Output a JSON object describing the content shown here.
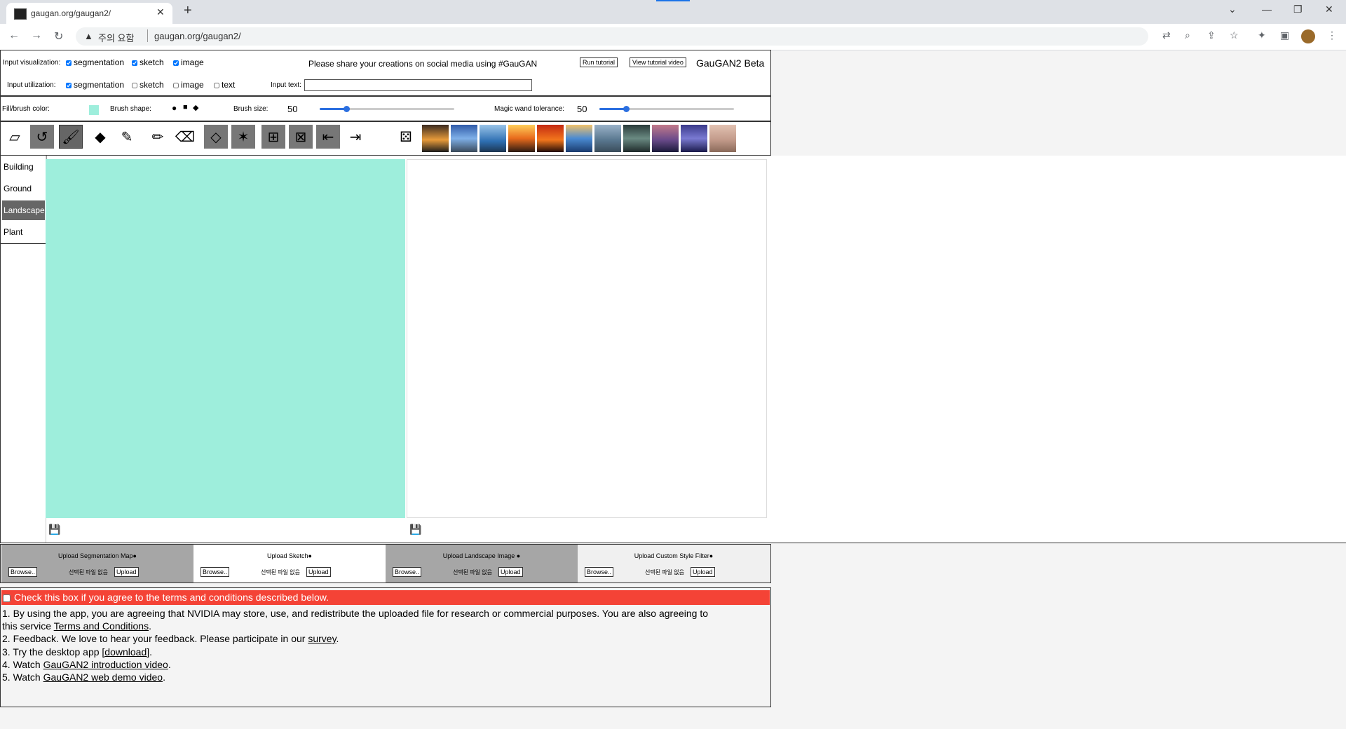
{
  "browser": {
    "tab_title": "gaugan.org/gaugan2/",
    "security_label": "주의 요함",
    "url": "gaugan.org/gaugan2/"
  },
  "header": {
    "input_visualization_label": "Input visualization:",
    "viz_options": [
      "segmentation",
      "sketch",
      "image"
    ],
    "share_text": "Please share your creations on social media using #GauGAN",
    "run_tutorial": "Run tutorial",
    "view_tutorial_video": "View tutorial video",
    "app_name": "GauGAN2 Beta",
    "input_utilization_label": "Input utilization:",
    "util_options": [
      "segmentation",
      "sketch",
      "image",
      "text"
    ],
    "input_text_label": "Input text:",
    "input_text_value": ""
  },
  "brush": {
    "fill_color_label": "Fill/brush color:",
    "fill_color": "#9eeedc",
    "brush_shape_label": "Brush shape:",
    "brush_size_label": "Brush size:",
    "brush_size": "50",
    "brush_size_fraction": 0.2,
    "magic_wand_label": "Magic wand tolerance:",
    "magic_wand": "50",
    "magic_wand_fraction": 0.2
  },
  "categories": [
    "Building",
    "Ground",
    "Landscape",
    "Plant"
  ],
  "selected_category": "Landscape",
  "uploads": [
    {
      "title": "Upload Segmentation Map●",
      "browse": "Browse..",
      "nofile": "선택된 파일 없음",
      "upload": "Upload"
    },
    {
      "title": "Upload Sketch●",
      "browse": "Browse..",
      "nofile": "선택된 파일 없음",
      "upload": "Upload"
    },
    {
      "title": "Upload Landscape Image ●",
      "browse": "Browse..",
      "nofile": "선택된 파일 없음",
      "upload": "Upload"
    },
    {
      "title": "Upload Custom Style Filter●",
      "browse": "Browse..",
      "nofile": "선택된 파일 없음",
      "upload": "Upload"
    }
  ],
  "terms": {
    "agree": "Check this box if you agree to the terms and conditions described below.",
    "l1a": "1. By using the app, you are agreeing that NVIDIA may store, use, and redistribute the uploaded file for research or commercial purposes. You are also agreeing to",
    "l1b": "this service ",
    "l1link": "Terms and Conditions",
    "l2a": "2. Feedback. We love to hear your feedback. Please participate in our ",
    "l2link": "survey",
    "l3a": "3. Try the desktop app ",
    "l3link": "[download]",
    "l4a": "4. Watch ",
    "l4link": "GauGAN2 introduction video",
    "l5a": "5. Watch ",
    "l5link": "GauGAN2 web demo video"
  },
  "colors": {
    "terms_bar": "#f44336",
    "segmentation_fill": "#9eeedc",
    "slider": "#2b6fe0"
  }
}
